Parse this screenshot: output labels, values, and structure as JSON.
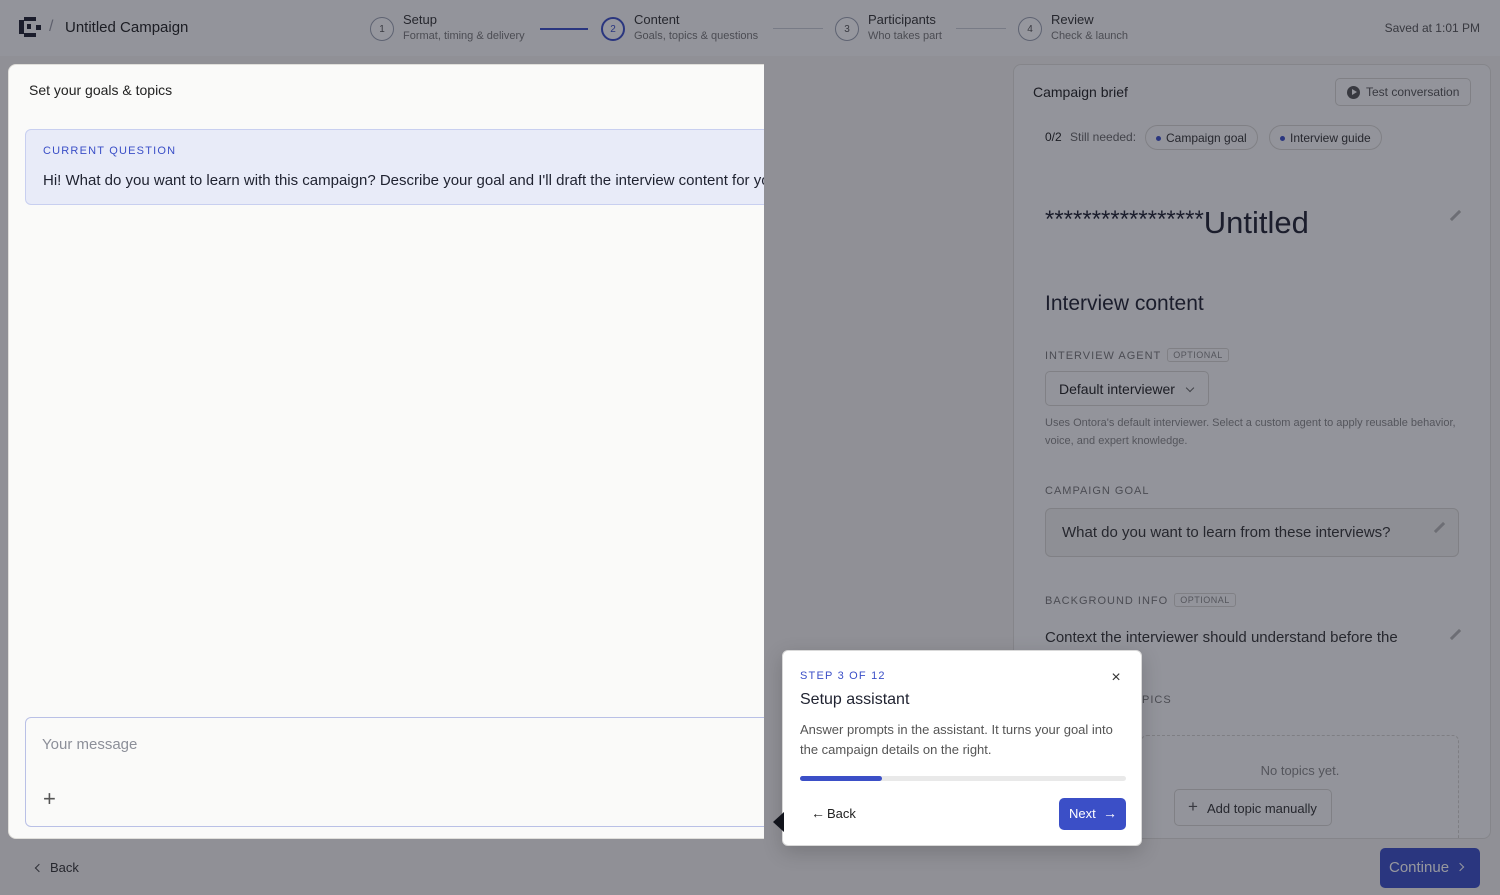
{
  "header": {
    "breadcrumb_sep": "/",
    "campaign_title": "Untitled Campaign",
    "saved_status": "Saved at 1:01 PM",
    "steps": [
      {
        "num": "1",
        "title": "Setup",
        "sub": "Format, timing & delivery"
      },
      {
        "num": "2",
        "title": "Content",
        "sub": "Goals, topics & questions"
      },
      {
        "num": "3",
        "title": "Participants",
        "sub": "Who takes part"
      },
      {
        "num": "4",
        "title": "Review",
        "sub": "Check & launch"
      }
    ],
    "active_step": 2
  },
  "chat": {
    "title": "Set your goals & topics",
    "question_label": "CURRENT QUESTION",
    "question_text": "Hi! What do you want to learn with this campaign? Describe your goal and I'll draft the interview content for you.",
    "composer_placeholder": "Your message",
    "composer_value": ""
  },
  "brief": {
    "title": "Campaign brief",
    "test_button": "Test conversation",
    "needed_count": "0/2",
    "needed_label": "Still needed:",
    "needed_chips": [
      "Campaign goal",
      "Interview guide"
    ],
    "campaign_name_stars": "*****************",
    "campaign_name": "Untitled",
    "section_title": "Interview content",
    "agent_label": "INTERVIEW AGENT",
    "optional_badge": "OPTIONAL",
    "agent_value": "Default interviewer",
    "agent_help": "Uses Ontora's default interviewer. Select a custom agent to apply reusable behavior, voice, and expert knowledge.",
    "goal_label": "CAMPAIGN GOAL",
    "goal_placeholder": "What do you want to learn from these interviews?",
    "background_label": "BACKGROUND INFO",
    "background_text": "Context the interviewer should understand before the",
    "topics_label_visible": "PICS",
    "no_topics": "No topics yet.",
    "add_topic_button": "Add topic manually"
  },
  "footer": {
    "back_label": "Back",
    "continue_label": "Continue"
  },
  "tour": {
    "step_label": "STEP 3 OF 12",
    "title": "Setup assistant",
    "close_glyph": "×",
    "body": "Answer prompts in the assistant. It turns your goal into the campaign details on the right.",
    "progress": 0.25,
    "back_label": "Back",
    "next_label": "Next"
  },
  "colors": {
    "accent": "#3b4fc7",
    "overlay": "rgba(22,25,40,0.45)"
  },
  "icons": [
    "logo-icon",
    "collapse-panel-icon",
    "play-icon",
    "pencil-icon",
    "chevron-down-icon",
    "plus-icon",
    "chevron-left-icon",
    "chevron-right-icon",
    "close-icon",
    "arrow-left-icon",
    "arrow-right-icon"
  ]
}
